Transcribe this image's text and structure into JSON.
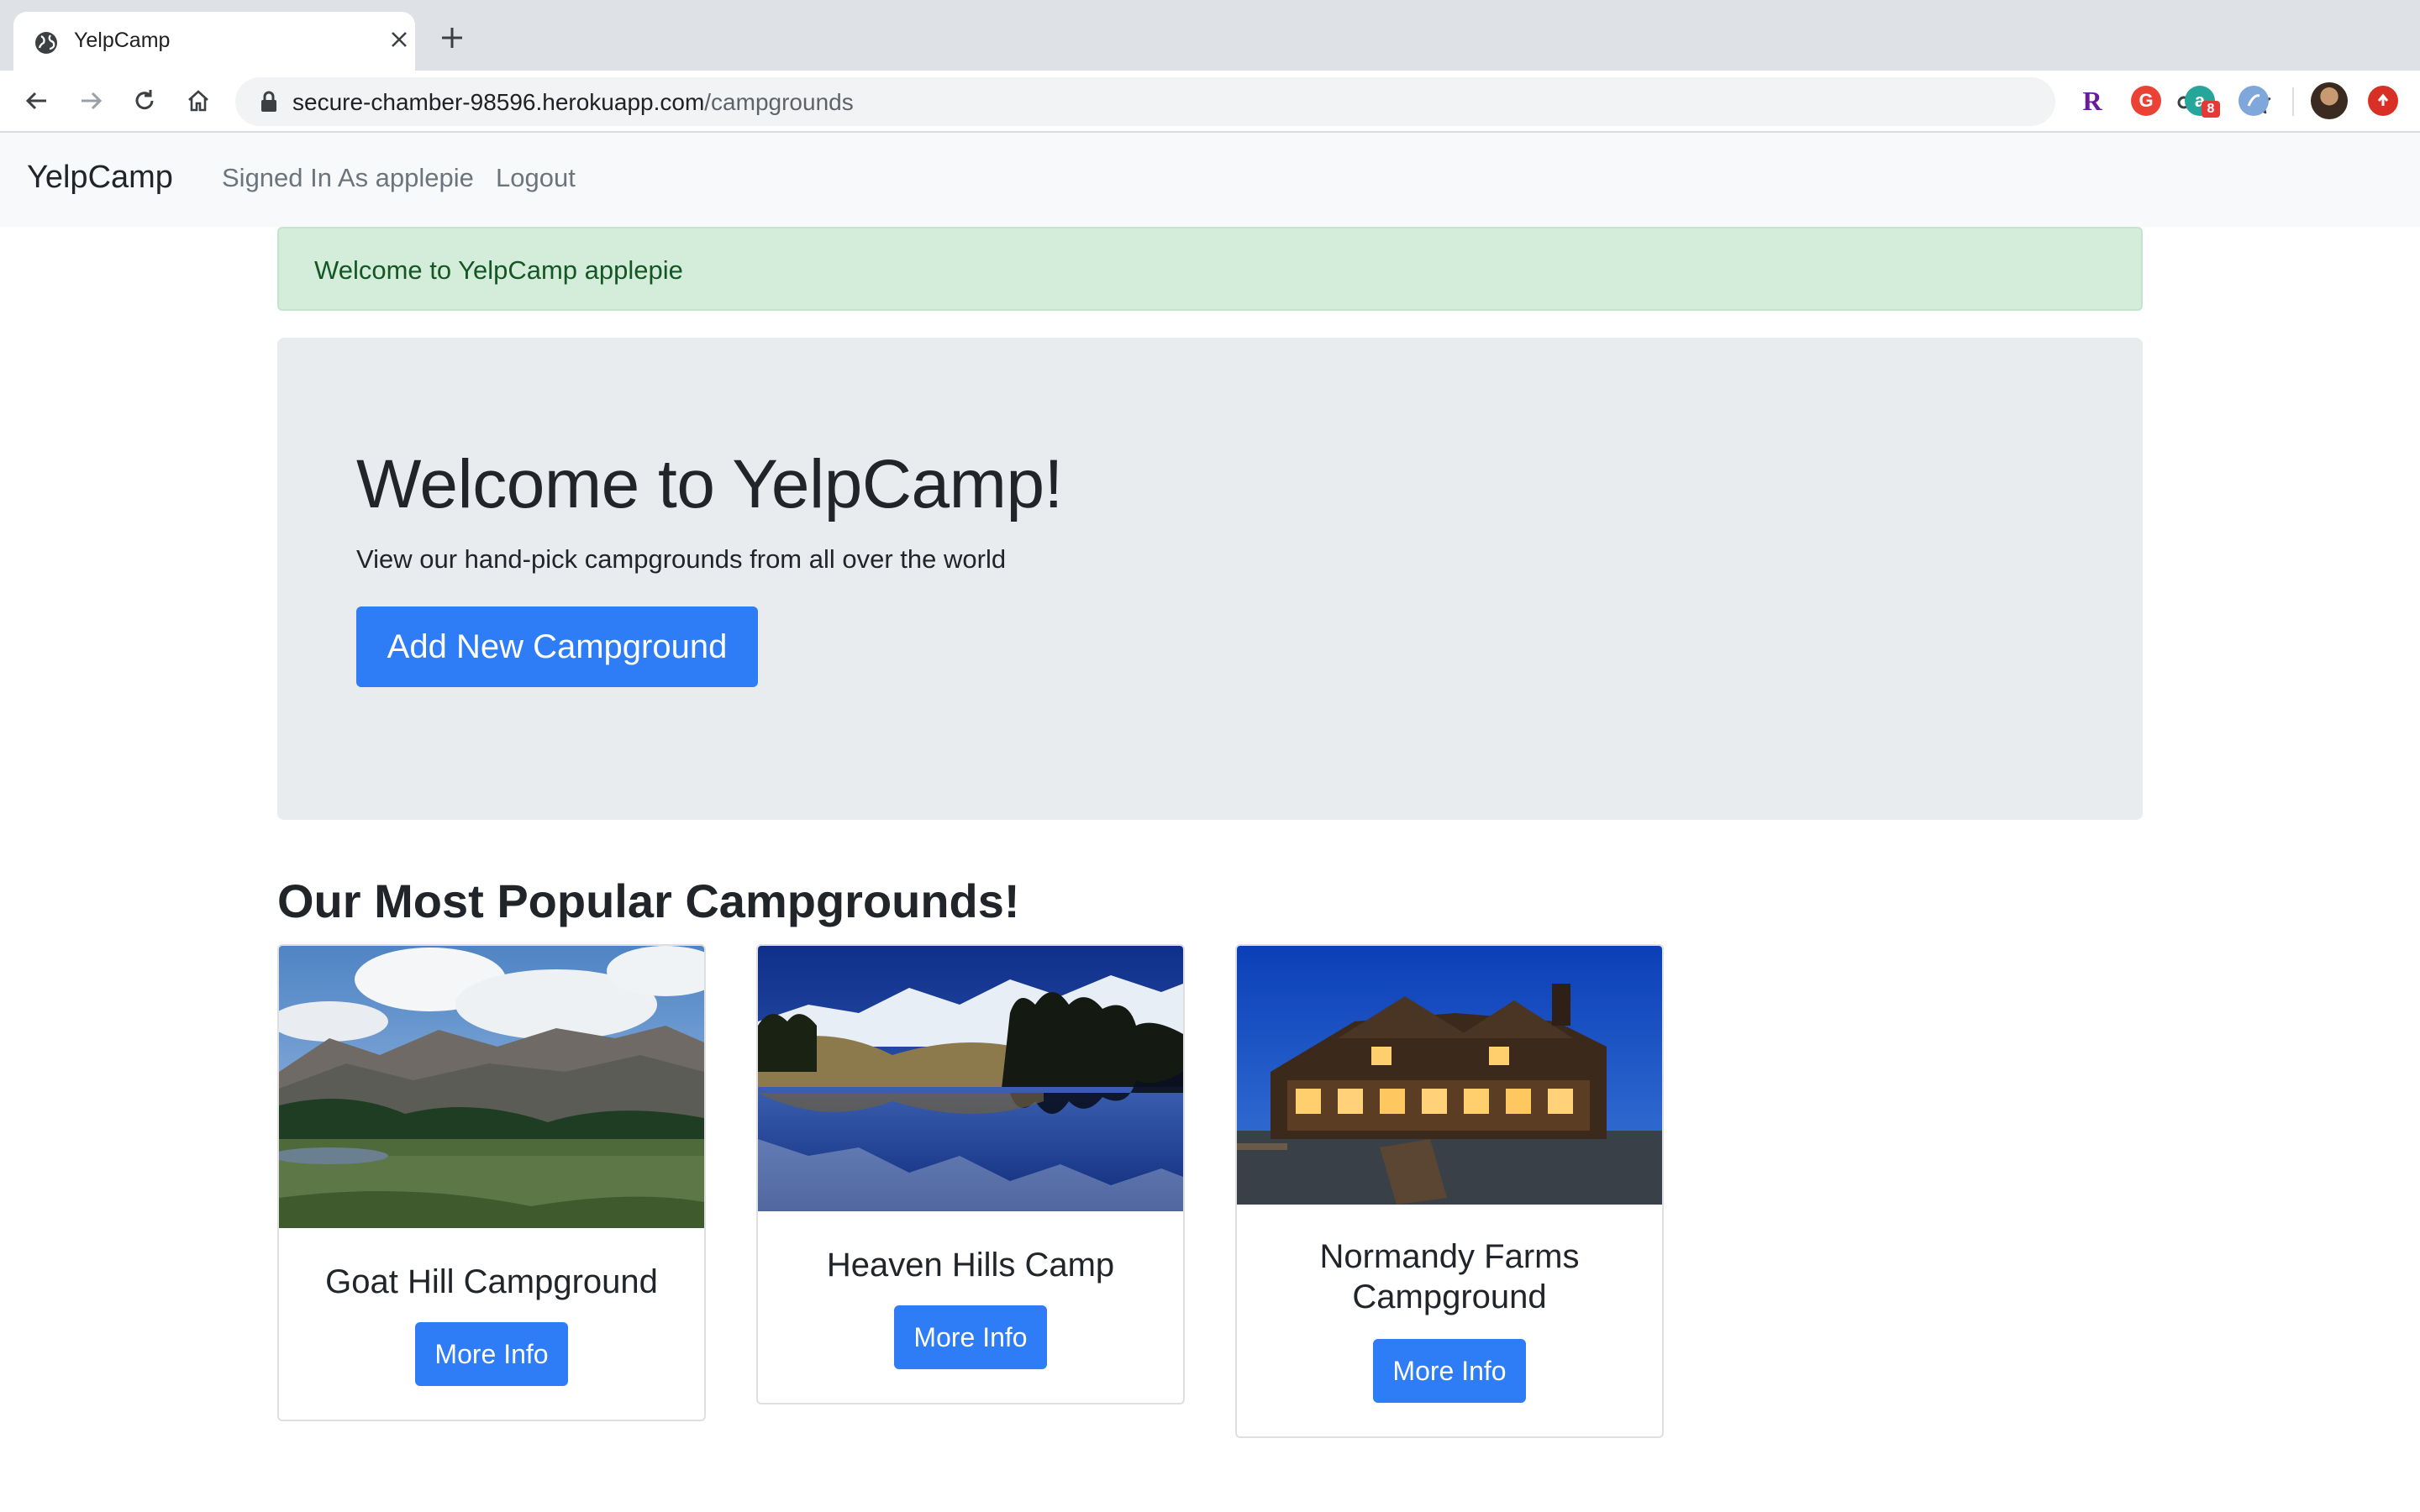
{
  "browser": {
    "tab_title": "YelpCamp",
    "url_host": "secure-chamber-98596.herokuapp.com",
    "url_path": "/campgrounds",
    "extensions": [
      {
        "name": "r-extension-icon",
        "label": "R",
        "color": "#6a1b9a"
      },
      {
        "name": "g-extension-icon",
        "label": "G",
        "color": "#ea4335"
      },
      {
        "name": "a-extension-icon",
        "label": "a",
        "color": "#26a69a",
        "badge": "8"
      },
      {
        "name": "globe-extension-icon",
        "label": "",
        "color": "#5c8fd6"
      }
    ]
  },
  "navbar": {
    "brand": "YelpCamp",
    "signed_in": "Signed In As applepie",
    "logout": "Logout"
  },
  "alert": {
    "text": "Welcome to YelpCamp applepie",
    "color": "#155724",
    "background": "#d4edda"
  },
  "hero": {
    "title": "Welcome to YelpCamp!",
    "subtitle": "View our hand-pick campgrounds from all over the world",
    "button": "Add New Campground"
  },
  "section": {
    "title": "Our Most Popular Campgrounds!"
  },
  "campgrounds": [
    {
      "name": "Goat Hill Campground",
      "button": "More Info"
    },
    {
      "name": "Heaven Hills Camp",
      "button": "More Info"
    },
    {
      "name": "Normandy Farms Campground",
      "button": "More Info"
    }
  ],
  "colors": {
    "primary": "#2e7cf6",
    "jumbotron": "#e9ecef",
    "navbar": "#f8f9fa"
  }
}
